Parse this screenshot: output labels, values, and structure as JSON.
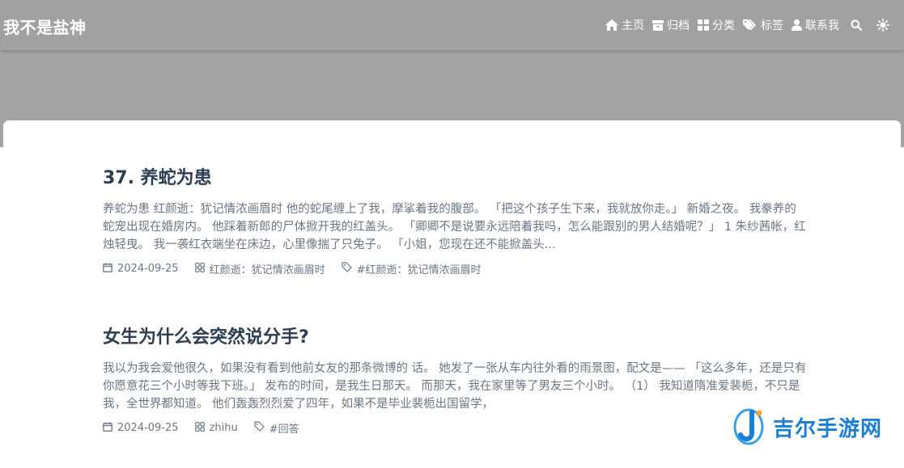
{
  "site": {
    "title": "我不是盐神"
  },
  "nav": {
    "items": [
      {
        "label": "主页",
        "icon": "home-icon"
      },
      {
        "label": "归档",
        "icon": "archive-icon"
      },
      {
        "label": "分类",
        "icon": "category-icon"
      },
      {
        "label": "标签",
        "icon": "tags-icon"
      },
      {
        "label": "联系我",
        "icon": "user-icon"
      }
    ],
    "search_icon": "search-icon",
    "theme_icon": "sun-icon"
  },
  "posts": [
    {
      "title": "37. 养蛇为患",
      "excerpt": "养蛇为患 红颜逝：犹记情浓画眉时 他的蛇尾缠上了我，摩挲着我的腹部。 「把这个孩子生下来，我就放你走。」 新婚之夜。 我豢养的蛇宠出现在婚房内。 他踩着新郎的尸体掀开我的红盖头。 「卿卿不是说要永远陪着我吗，怎么能跟别的男人结婚呢？」 1 朱纱茜帐，红烛轻曳。 我一袭红衣端坐在床边，心里像揣了只兔子。 「小姐，您现在还不能掀盖头...",
      "date": "2024-09-25",
      "category": "红颜逝：犹记情浓画眉时",
      "tag": "#红颜逝：犹记情浓画眉时"
    },
    {
      "title": "女生为什么会突然说分手?",
      "excerpt": "我以为我会爱他很久，如果没有看到他前女友的那条微博的 话。 她发了一张从车内往外看的雨景图，配文是—— 「这么多年，还是只有你愿意花三个小时等我下班。」 发布的时间，是我生日那天。 而那天，我在家里等了男友三个小时。 （1） 我知道隋准爱裴栀，不只是我，全世界都知道。 他们轰轰烈烈爱了四年，如果不是毕业裴栀出国留学，",
      "date": "2024-09-25",
      "category": "zhihu",
      "tag": "#回答"
    }
  ],
  "watermark": {
    "text": "吉尔手游网"
  },
  "colors": {
    "header_bg": "#a1a1a1",
    "title_color": "#2c3e50",
    "text_muted": "#6b7684",
    "watermark_blue": "#1a7fd4"
  }
}
